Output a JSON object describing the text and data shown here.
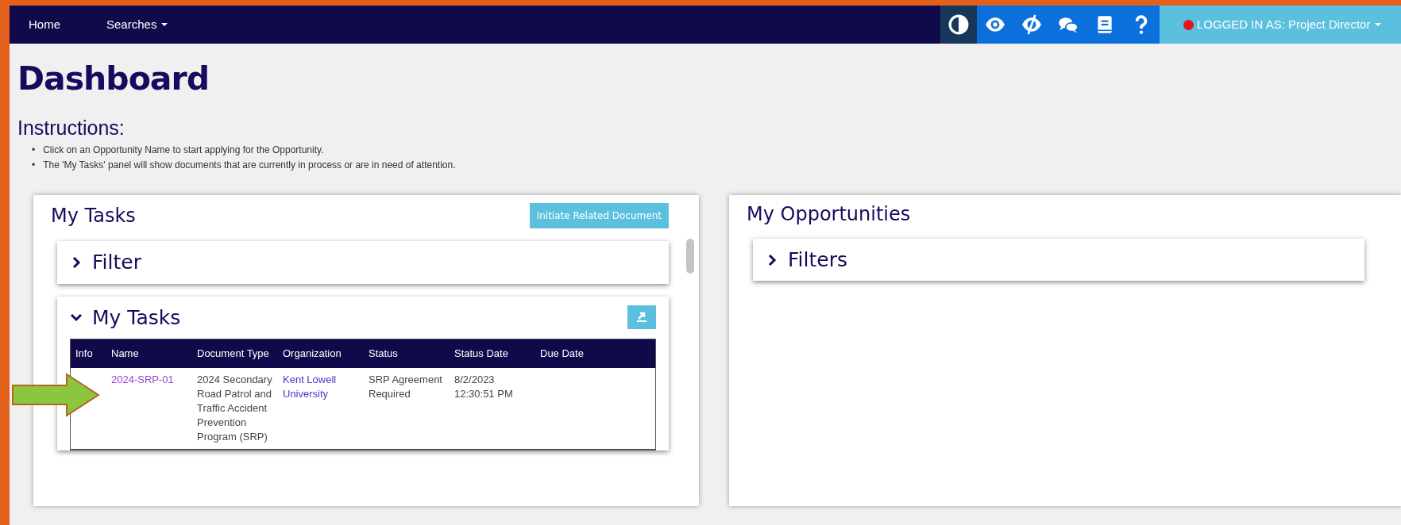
{
  "navbar": {
    "items": [
      {
        "label": "Home",
        "dropdown": false
      },
      {
        "label": "Searches",
        "dropdown": true
      }
    ],
    "tools": [
      {
        "kind": "contrast",
        "active": true
      },
      {
        "kind": "eye",
        "active": false
      },
      {
        "kind": "eye-slash",
        "active": false
      },
      {
        "kind": "chat",
        "active": false
      },
      {
        "kind": "book",
        "active": false
      },
      {
        "kind": "help",
        "active": false
      }
    ],
    "user": {
      "label": "LOGGED IN AS: Project Director"
    }
  },
  "page_title": "Dashboard",
  "instructions": {
    "heading": "Instructions:",
    "items": [
      {
        "bullet": "•",
        "text": "Click on an Opportunity Name to start applying for the Opportunity."
      },
      {
        "bullet": "•",
        "text": "The 'My Tasks' panel will show documents that are currently in process or are in need of attention."
      }
    ]
  },
  "tasks_panel": {
    "title": "My Tasks",
    "button": "Initiate Related Document",
    "sections": [
      {
        "title": "Filter",
        "expanded": false
      },
      {
        "title": "My Tasks",
        "expanded": true
      }
    ],
    "table": {
      "columns": [
        "Info",
        "Name",
        "Document Type",
        "Organization",
        "Status",
        "Status Date",
        "Due Date"
      ],
      "rows": [
        {
          "name": "2024-SRP-01",
          "document_type": "2024 Secondary Road Patrol and Traffic Accident Prevention Program (SRP)",
          "organization": "Kent Lowell University",
          "status": "SRP Agreement Required",
          "status_date": "8/2/2023 12:30:51 PM"
        }
      ]
    }
  },
  "opportunities_panel": {
    "title": "My Opportunities",
    "sections": [
      {
        "title": "Filters",
        "expanded": false
      }
    ]
  }
}
